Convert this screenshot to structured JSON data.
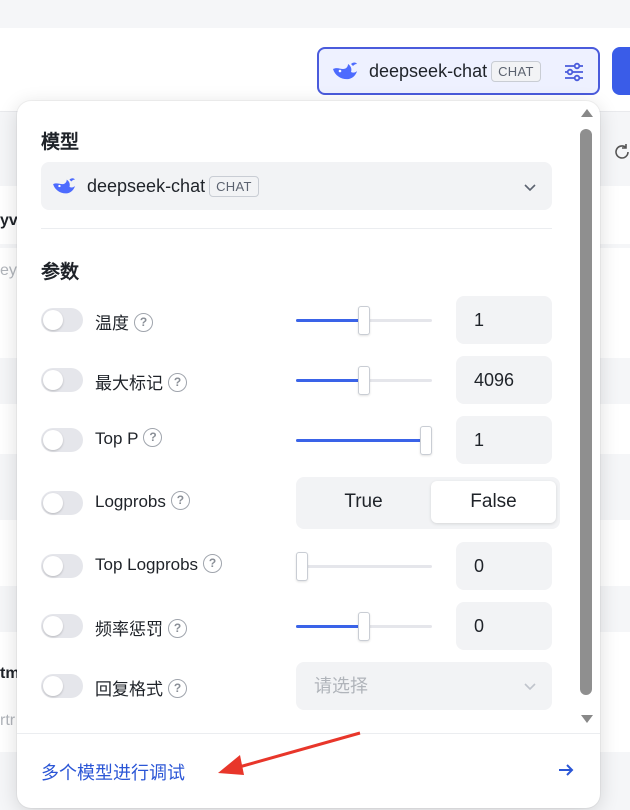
{
  "header": {
    "model_name": "deepseek-chat",
    "badge": "CHAT",
    "bg_fragments": [
      "yv",
      "ey",
      "tm",
      "rtr"
    ]
  },
  "popover": {
    "model_section_title": "模型",
    "model_select": {
      "name": "deepseek-chat",
      "badge": "CHAT"
    },
    "params_section_title": "参数",
    "params": [
      {
        "label": "温度",
        "value": "1",
        "slider_fraction": 0.5
      },
      {
        "label": "最大标记",
        "value": "4096",
        "slider_fraction": 0.5
      },
      {
        "label": "Top P",
        "value": "1",
        "slider_fraction": 0.96
      },
      {
        "label": "Logprobs",
        "options": [
          "True",
          "False"
        ],
        "selected": "False"
      },
      {
        "label": "Top Logprobs",
        "value": "0",
        "slider_fraction": 0.0
      },
      {
        "label": "频率惩罚",
        "value": "0",
        "slider_fraction": 0.5
      },
      {
        "label": "回复格式",
        "placeholder": "请选择"
      }
    ],
    "help_glyph": "?",
    "footer_link": "多个模型进行调试"
  },
  "colors": {
    "accent": "#3a63e8",
    "link": "#2b56d6",
    "annotation_arrow": "#e8362a"
  }
}
